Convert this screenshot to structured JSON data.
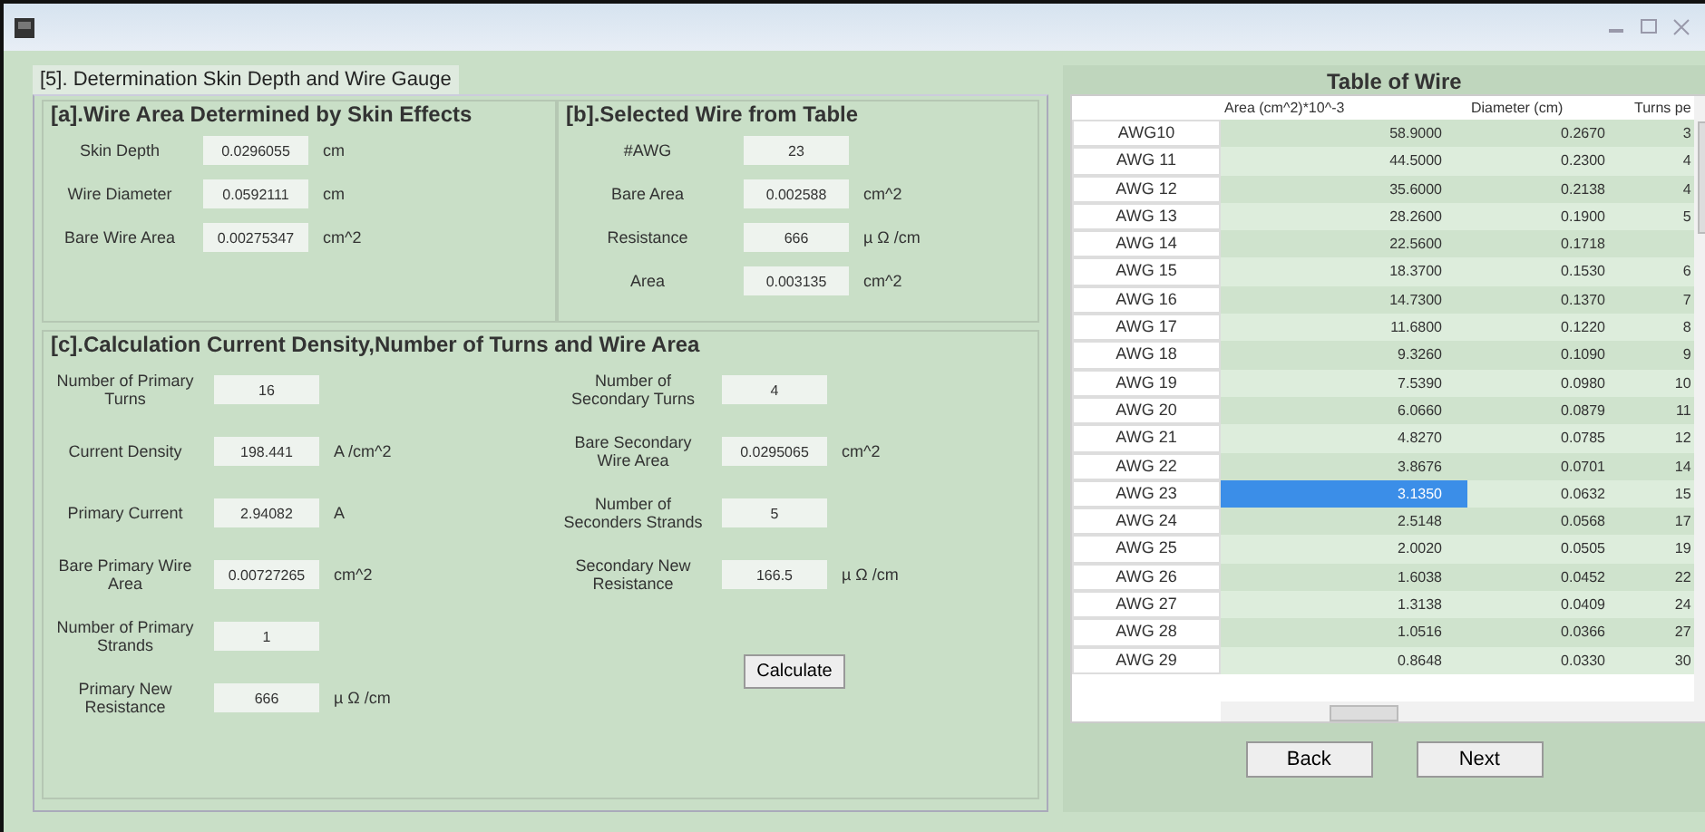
{
  "title": "[5]. Determination Skin Depth and Wire Gauge",
  "section_a": {
    "title": "[a].Wire Area Determined by Skin Effects",
    "fields": [
      {
        "label": "Skin Depth",
        "value": "0.0296055",
        "unit": "cm"
      },
      {
        "label": "Wire Diameter",
        "value": "0.0592111",
        "unit": "cm"
      },
      {
        "label": "Bare Wire Area",
        "value": "0.00275347",
        "unit": "cm^2"
      }
    ]
  },
  "section_b": {
    "title": "[b].Selected Wire from Table",
    "fields": [
      {
        "label": "#AWG",
        "value": "23"
      },
      {
        "label": "Bare Area",
        "value": "0.002588",
        "unit": "cm^2"
      },
      {
        "label": "Resistance",
        "value": "666",
        "unit": "µ Ω /cm"
      },
      {
        "label": "Area",
        "value": "0.003135",
        "unit": "cm^2"
      }
    ]
  },
  "section_c": {
    "title": "[c].Calculation Current Density,Number of Turns and Wire Area",
    "left_fields": [
      {
        "label": "Number of Primary Turns",
        "value": "16"
      },
      {
        "label": "Current Density",
        "value": "198.441",
        "unit": "A /cm^2"
      },
      {
        "label": "Primary Current",
        "value": "2.94082",
        "unit": "A"
      },
      {
        "label": "Bare Primary Wire Area",
        "value": "0.00727265",
        "unit": "cm^2"
      },
      {
        "label": "Number of Primary Strands",
        "value": "1"
      },
      {
        "label": "Primary New Resistance",
        "value": "666",
        "unit": "µ Ω /cm"
      }
    ],
    "right_fields": [
      {
        "label": "Number of Secondary Turns",
        "value": "4"
      },
      {
        "label": "Bare Secondary Wire Area",
        "value": "0.0295065",
        "unit": "cm^2"
      },
      {
        "label": "Number of Seconders Strands",
        "value": "5"
      },
      {
        "label": "Secondary New Resistance",
        "value": "166.5",
        "unit": "µ Ω /cm"
      }
    ],
    "button": "Calculate"
  },
  "table": {
    "title": "Table of Wire",
    "columns": [
      "Area (cm^2)*10^-3",
      "Diameter (cm)",
      "Turns pe"
    ],
    "rows": [
      {
        "name": "AWG10",
        "cells": [
          "58.9000",
          "0.2670",
          "3"
        ],
        "selected": false
      },
      {
        "name": "AWG 11",
        "cells": [
          "44.5000",
          "0.2300",
          "4"
        ],
        "selected": false
      },
      {
        "name": "AWG 12",
        "cells": [
          "35.6000",
          "0.2138",
          "4"
        ],
        "selected": false
      },
      {
        "name": "AWG 13",
        "cells": [
          "28.2600",
          "0.1900",
          "5"
        ],
        "selected": false
      },
      {
        "name": "AWG 14",
        "cells": [
          "22.5600",
          "0.1718",
          null
        ],
        "selected": false
      },
      {
        "name": "AWG 15",
        "cells": [
          "18.3700",
          "0.1530",
          "6"
        ],
        "selected": false
      },
      {
        "name": "AWG 16",
        "cells": [
          "14.7300",
          "0.1370",
          "7"
        ],
        "selected": false
      },
      {
        "name": "AWG 17",
        "cells": [
          "11.6800",
          "0.1220",
          "8"
        ],
        "selected": false
      },
      {
        "name": "AWG 18",
        "cells": [
          "9.3260",
          "0.1090",
          "9"
        ],
        "selected": false
      },
      {
        "name": "AWG 19",
        "cells": [
          "7.5390",
          "0.0980",
          "10"
        ],
        "selected": false
      },
      {
        "name": "AWG 20",
        "cells": [
          "6.0660",
          "0.0879",
          "11"
        ],
        "selected": false
      },
      {
        "name": "AWG 21",
        "cells": [
          "4.8270",
          "0.0785",
          "12"
        ],
        "selected": false
      },
      {
        "name": "AWG 22",
        "cells": [
          "3.8676",
          "0.0701",
          "14"
        ],
        "selected": false
      },
      {
        "name": "AWG 23",
        "cells": [
          "3.1350",
          "0.0632",
          "15"
        ],
        "selected": true
      },
      {
        "name": "AWG 24",
        "cells": [
          "2.5148",
          "0.0568",
          "17"
        ],
        "selected": false
      },
      {
        "name": "AWG 25",
        "cells": [
          "2.0020",
          "0.0505",
          "19"
        ],
        "selected": false
      },
      {
        "name": "AWG 26",
        "cells": [
          "1.6038",
          "0.0452",
          "22"
        ],
        "selected": false
      },
      {
        "name": "AWG 27",
        "cells": [
          "1.3138",
          "0.0409",
          "24"
        ],
        "selected": false
      },
      {
        "name": "AWG 28",
        "cells": [
          "1.0516",
          "0.0366",
          "27"
        ],
        "selected": false
      },
      {
        "name": "AWG 29",
        "cells": [
          "0.8648",
          "0.0330",
          "30"
        ],
        "selected": false
      }
    ]
  },
  "buttons": [
    "Back",
    "Next"
  ]
}
